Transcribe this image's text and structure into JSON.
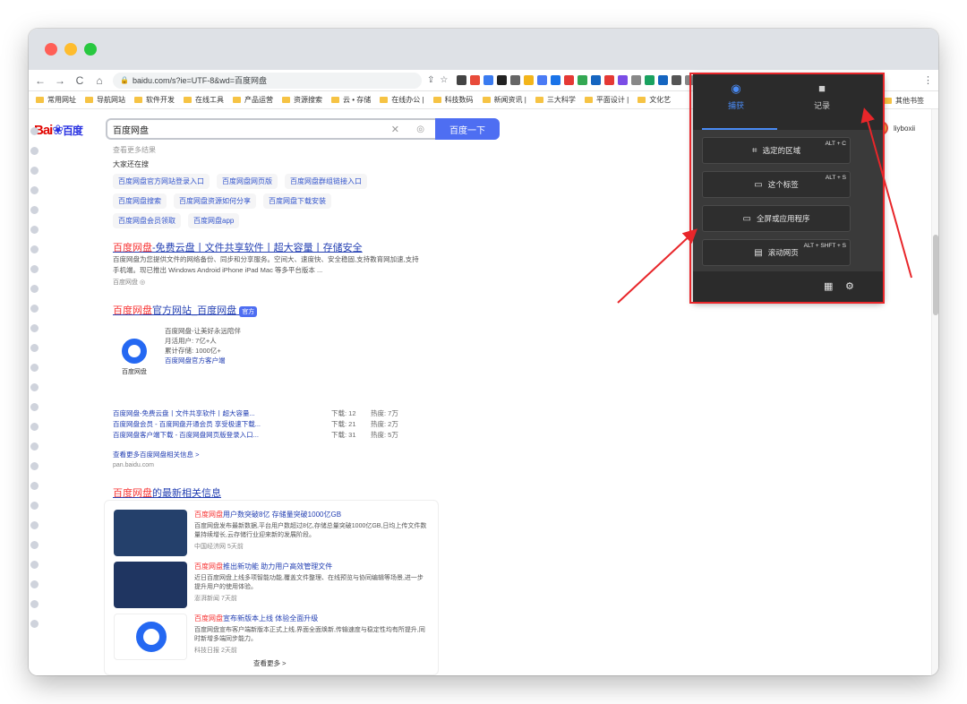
{
  "browser": {
    "url": "baidu.com/s?ie=UTF-8&wd=百度网盘",
    "bookmarks": [
      "常用网址",
      "导航网站",
      "软件开发",
      "在线工具",
      "产品运营",
      "资源搜索",
      "云 • 存储",
      "在线办公 |",
      "科技数码",
      "新闻资讯 |",
      "三大科学",
      "平面设计 |",
      "文化艺"
    ],
    "other_bookmarks": "其他书签",
    "more_bookmarks": "»",
    "extensions": [
      "#444",
      "#e84b3a",
      "#3a7bf0",
      "#222",
      "#666",
      "#f3b51b",
      "#4a7bf5",
      "#1a73e8",
      "#e53935",
      "#34a853",
      "#1565c0",
      "#e53935",
      "#7b4de6",
      "#888",
      "#1aa260",
      "#1565c0",
      "#555",
      "#888",
      "#e53935",
      "#f48fb1",
      "#e53935",
      "#2e7d32",
      "#333",
      "#222",
      "#f6b100",
      "#666",
      "#444",
      "#333"
    ]
  },
  "baidu": {
    "logo_bai": "Bai",
    "logo_du": "百度",
    "query": "百度网盘",
    "search_button": "百度一下",
    "user": "liyboxii",
    "cut_line": "查看更多结果",
    "related_title": "大家还在搜",
    "chips_row1": [
      "百度网盘官方网站登录入口",
      "百度网盘网页版",
      "百度网盘群组链接入口"
    ],
    "chips_row2": [
      "百度网盘搜索",
      "百度网盘资源如何分享",
      "百度网盘下载安装"
    ],
    "chips_row3": [
      "百度网盘会员领取",
      "百度网盘app"
    ],
    "result1": {
      "title_hl": "百度网盘",
      "title_rest": "-免费云盘丨文件共享软件丨超大容量丨存储安全",
      "snippet1": "百度网盘为您提供文件的网络备份、同步和分享服务。空间大、速度快、安全稳固,支持教育网加速,支持",
      "snippet2": "手机端。现已推出 Windows Android iPhone iPad Mac 等多平台版本 ...",
      "source": "百度网盘  ◎"
    },
    "result2": {
      "title_hl": "百度网盘",
      "title_rest": "官方网站_百度网盘",
      "badge": "官方",
      "card_lines": [
        "百度网盘-让美好永远陪伴",
        "月活用户: 7亿+人",
        "累计存储: 1000亿+",
        "百度网盘官方客户端"
      ],
      "logo_label": "百度网盘",
      "links": [
        [
          "百度网盘-免费云盘丨文件共享软件丨超大容量...",
          "下载: 12",
          "热度: 7万"
        ],
        [
          "百度网盘会员 - 百度网盘开通会员 享受极速下载...",
          "下载: 21",
          "热度: 2万"
        ],
        [
          "百度网盘客户端下载 - 百度网盘网页版登录入口...",
          "下载: 31",
          "热度: 5万"
        ]
      ],
      "more": "查看更多百度网盘相关信息 >",
      "url": "pan.baidu.com"
    },
    "news": {
      "title_hl": "百度网盘",
      "title_rest": "的最新相关信息",
      "items": [
        {
          "title_hl": "百度网盘",
          "title_rest": "用户数突破8亿 存储量突破1000亿GB",
          "snippet": "百度网盘发布最新数据,平台用户数超过8亿,存储总量突破1000亿GB,日均上传文件数量持续增长,云存储行业迎来新的发展阶段。",
          "meta": "中国经济网  5天前",
          "thumb": "#24406b"
        },
        {
          "title_hl": "百度网盘",
          "title_rest": "推出新功能 助力用户高效管理文件",
          "snippet": "近日百度网盘上线多项智能功能,覆盖文件整理、在线预览与协同编辑等场景,进一步提升用户的使用体验。",
          "meta": "澎湃新闻  7天前",
          "thumb": "#1f3561"
        },
        {
          "title_hl": "百度网盘",
          "title_rest": "宣布新版本上线 体验全面升级",
          "snippet": "百度网盘宣布客户端新版本正式上线,界面全面焕新,传输速度与稳定性均有所提升,同时新增多端同步能力。",
          "meta": "科技日报  2天前",
          "thumb": "#ffffff"
        }
      ],
      "more": "查看更多 >"
    }
  },
  "capture_popup": {
    "tab_capture": "捕获",
    "tab_record": "记录",
    "buttons": [
      {
        "label": "选定的区域",
        "shortcut": "ALT + C"
      },
      {
        "label": "这个标签",
        "shortcut": "ALT + S"
      },
      {
        "label": "全屏或应用程序",
        "shortcut": ""
      },
      {
        "label": "滚动网页",
        "shortcut": "ALT + SHFT + S"
      }
    ]
  },
  "colors": {
    "accent_blue": "#4a8bf5",
    "annotation_red": "#e8262a",
    "baidu_blue": "#4e6ef2"
  }
}
